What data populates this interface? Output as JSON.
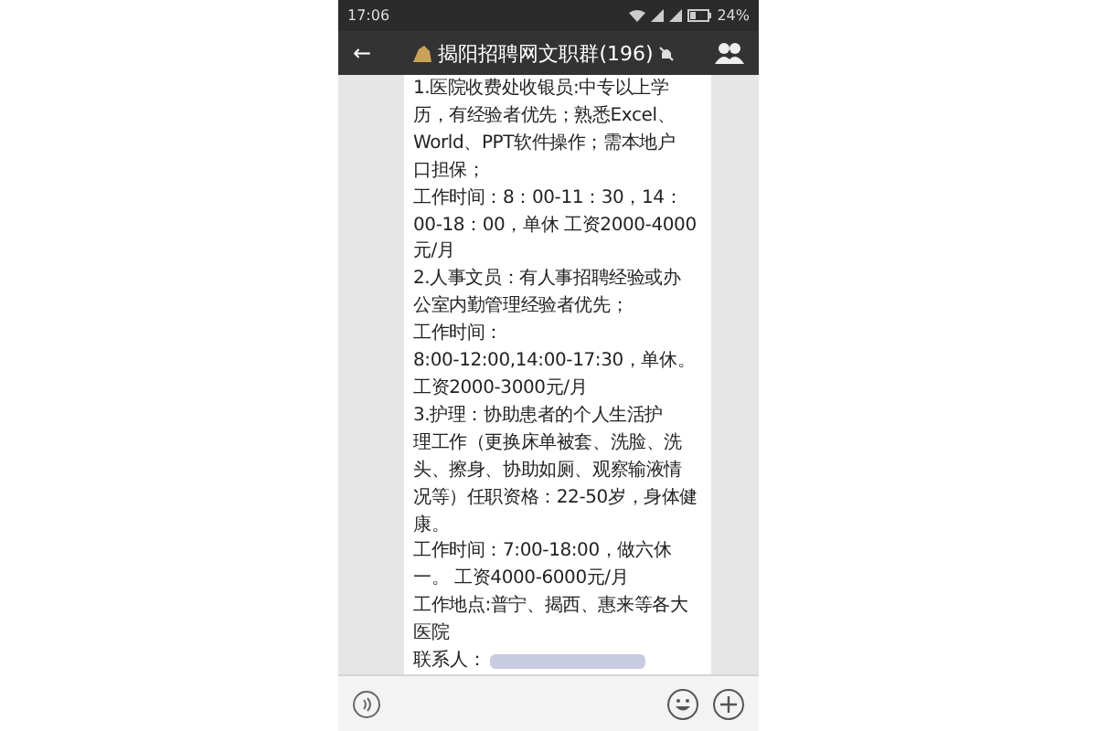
{
  "status_bar": {
    "time": "17:06",
    "battery": "24%"
  },
  "title_bar": {
    "back": "←",
    "title": "揭阳招聘网文职群(196)",
    "muted": true
  },
  "message": {
    "lines": [
      "1.医院收费处收银员:中专以上学",
      "历，有经验者优先；熟悉Excel、",
      "World、PPT软件操作；需本地户",
      "口担保；",
      "工作时间：8：00-11：30，14：",
      "00-18：00，单休  工资2000-4000",
      "元/月",
      "2.人事文员：有人事招聘经验或办",
      "公室内勤管理经验者优先；",
      "工作时间：",
      "8:00-12:00,14:00-17:30，单休。",
      "工资2000-3000元/月",
      "3.护理：协助患者的个人生活护",
      "理工作（更换床单被套、洗脸、洗",
      "头、擦身、协助如厕、观察输液情",
      "况等）任职资格：22-50岁，身体健",
      "康。",
      "工作时间：7:00-18:00，做六休",
      "一。 工资4000-6000元/月",
      "工作地点:普宁、揭西、惠来等各大",
      "医院"
    ],
    "contact_label": "联系人："
  }
}
